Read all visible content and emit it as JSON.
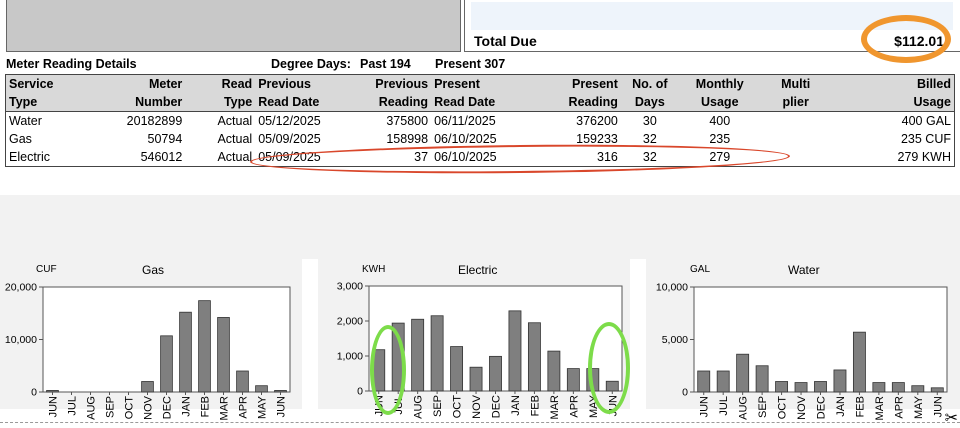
{
  "summary": {
    "total_label": "Total Due",
    "total_amount": "$112.01"
  },
  "meter_section": {
    "title": "Meter Reading Details",
    "degree_days_label": "Degree Days:",
    "degree_days_past": "Past 194",
    "degree_days_present": "Present 307",
    "headers": [
      [
        "Service",
        "Type"
      ],
      [
        "Meter",
        "Number"
      ],
      [
        "Read",
        "Type"
      ],
      [
        "Previous",
        "Read Date"
      ],
      [
        "Previous",
        "Reading"
      ],
      [
        "Present",
        "Read Date"
      ],
      [
        "Present",
        "Reading"
      ],
      [
        "No. of",
        "Days"
      ],
      [
        "Monthly",
        "Usage"
      ],
      [
        "Multi",
        "plier"
      ],
      [
        "Billed",
        "Usage"
      ]
    ],
    "rows": [
      [
        "Water",
        "20182899",
        "Actual",
        "05/12/2025",
        "375800",
        "06/11/2025",
        "376200",
        "30",
        "400",
        "",
        "400 GAL"
      ],
      [
        "Gas",
        "50794",
        "Actual",
        "05/09/2025",
        "158998",
        "06/10/2025",
        "159233",
        "32",
        "235",
        "",
        "235 CUF"
      ],
      [
        "Electric",
        "546012",
        "Actual",
        "05/09/2025",
        "37",
        "06/10/2025",
        "316",
        "32",
        "279",
        "",
        "279 KWH"
      ]
    ]
  },
  "chart_data": [
    {
      "type": "bar",
      "title": "Gas",
      "unit_label": "CUF",
      "categories": [
        "JUN",
        "JUL",
        "AUG",
        "SEP",
        "OCT",
        "NOV",
        "DEC",
        "JAN",
        "FEB",
        "MAR",
        "APR",
        "MAY",
        "JUN"
      ],
      "values": [
        300,
        0,
        0,
        0,
        0,
        2000,
        10700,
        15200,
        17400,
        14200,
        4000,
        1200,
        300
      ],
      "yticks": [
        "0",
        "10,000",
        "20,000"
      ],
      "ylim": [
        0,
        20000
      ],
      "grid": false
    },
    {
      "type": "bar",
      "title": "Electric",
      "unit_label": "KWH",
      "categories": [
        "JUN",
        "JUL",
        "AUG",
        "SEP",
        "OCT",
        "NOV",
        "DEC",
        "JAN",
        "FEB",
        "MAR",
        "APR",
        "MAY",
        "JUN"
      ],
      "values": [
        1180,
        1940,
        2050,
        2150,
        1270,
        680,
        990,
        2290,
        1950,
        1140,
        640,
        640,
        279
      ],
      "yticks": [
        "0",
        "1,000",
        "2,000",
        "3,000"
      ],
      "ylim": [
        0,
        3000
      ],
      "grid": false
    },
    {
      "type": "bar",
      "title": "Water",
      "unit_label": "GAL",
      "categories": [
        "JUN",
        "JUL",
        "AUG",
        "SEP",
        "OCT",
        "NOV",
        "DEC",
        "JAN",
        "FEB",
        "MAR",
        "APR",
        "MAY",
        "JUN"
      ],
      "values": [
        2000,
        2000,
        3600,
        2500,
        1000,
        900,
        1000,
        2100,
        5700,
        900,
        900,
        600,
        400
      ],
      "yticks": [
        "0",
        "5,000",
        "10,000"
      ],
      "ylim": [
        0,
        10000
      ],
      "grid": false
    }
  ],
  "colors": {
    "bar_fill": "#7f7f7f",
    "highlight_orange": "#f0962e",
    "highlight_red": "#d9472b",
    "highlight_green": "#7ddc4a"
  }
}
